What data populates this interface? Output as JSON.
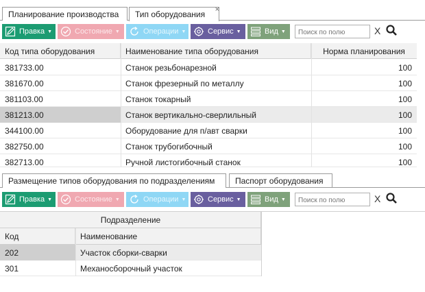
{
  "top_tabs": [
    {
      "label": "Планирование производства"
    },
    {
      "label": "Тип оборудования",
      "close": "×"
    }
  ],
  "toolbar": {
    "edit_label": "Правка",
    "state_label": "Состояние",
    "operations_label": "Операции",
    "service_label": "Сервис",
    "view_label": "Вид",
    "search_placeholder": "Поиск по полю",
    "clear_label": "X"
  },
  "equipment_table": {
    "columns": [
      "Код типа оборудования",
      "Наименование типа оборудования",
      "Норма планирования"
    ],
    "rows": [
      {
        "code": "381733.00",
        "name": "Станок резьбонарезной",
        "norm": "100"
      },
      {
        "code": "381670.00",
        "name": "Станок фрезерный по металлу",
        "norm": "100"
      },
      {
        "code": "381103.00",
        "name": "Станок токарный",
        "norm": "100"
      },
      {
        "code": "381213.00",
        "name": "Станок вертикально-сверлильный",
        "norm": "100"
      },
      {
        "code": "344100.00",
        "name": "Оборудование для п/авт сварки",
        "norm": "100"
      },
      {
        "code": "382750.00",
        "name": "Станок трубогибочный",
        "norm": "100"
      },
      {
        "code": "382713.00",
        "name": "Ручной листогибочный станок",
        "norm": "100"
      }
    ]
  },
  "bottom_tabs": [
    {
      "label": "Размещение типов оборудования по подразделениям"
    },
    {
      "label": "Паспорт оборудования"
    }
  ],
  "division_table": {
    "group_header": "Подразделение",
    "columns": [
      "Код",
      "Наименование"
    ],
    "rows": [
      {
        "code": "202",
        "name": "Участок сборки-сварки"
      },
      {
        "code": "301",
        "name": "Механосборочный участок"
      }
    ]
  },
  "colors": {
    "edit": "#1c9c72",
    "state": "#f0a8b1",
    "operations": "#8fd7f5",
    "service": "#695f9f",
    "view": "#7fa27b"
  }
}
